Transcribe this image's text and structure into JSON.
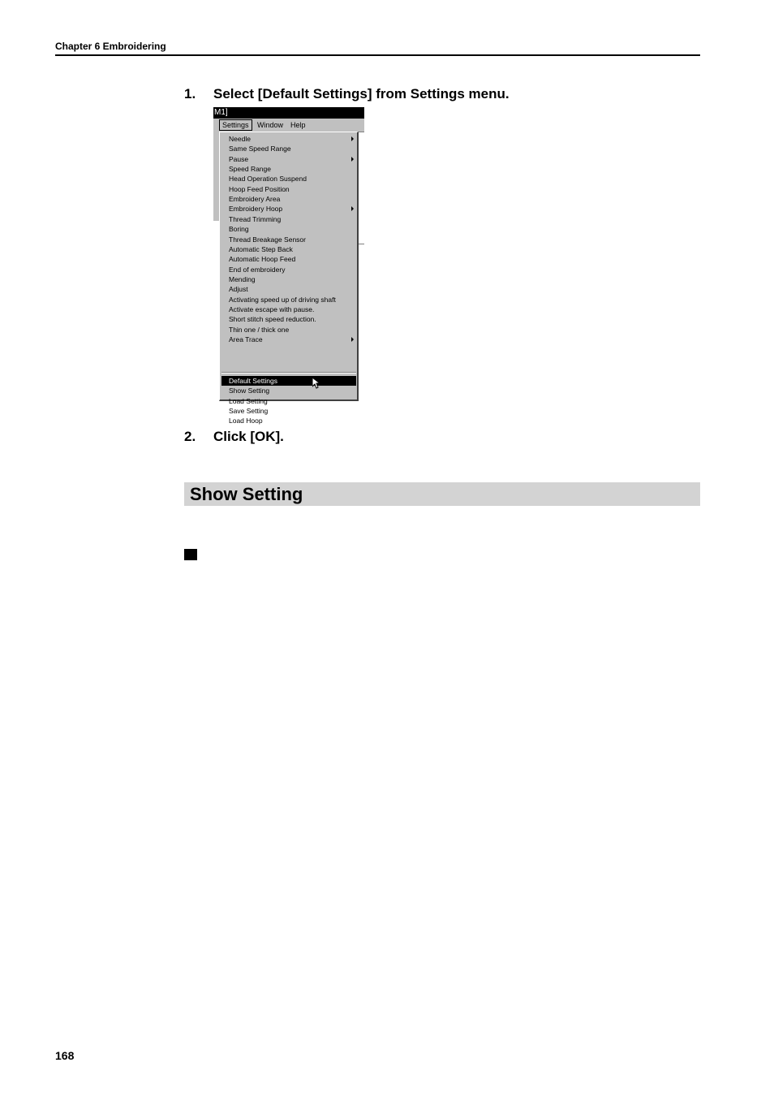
{
  "header": {
    "chapter": "Chapter 6  Embroidering"
  },
  "steps": [
    {
      "number": "1.",
      "text": "Select [Default Settings] from Settings menu."
    },
    {
      "number": "2.",
      "text": "Click [OK]."
    }
  ],
  "screenshot": {
    "title_fragment": "M1]",
    "menubar": [
      "Settings",
      "Window",
      "Help"
    ],
    "active_menu": "Settings",
    "menu_items": [
      {
        "label": "Needle",
        "submenu": true
      },
      {
        "label": "Same Speed Range",
        "submenu": false
      },
      {
        "label": "Pause",
        "submenu": true
      },
      {
        "label": "Speed Range",
        "submenu": false
      },
      {
        "label": "Head Operation Suspend",
        "submenu": false
      },
      {
        "label": "Hoop Feed Position",
        "submenu": false
      },
      {
        "label": "Embroidery Area",
        "submenu": false
      },
      {
        "label": "Embroidery Hoop",
        "submenu": true
      },
      {
        "label": "Thread Trimming",
        "submenu": false
      },
      {
        "label": "Boring",
        "submenu": false
      },
      {
        "label": "Thread Breakage Sensor",
        "submenu": false
      },
      {
        "label": "Automatic Step Back",
        "submenu": false
      },
      {
        "label": "Automatic Hoop Feed",
        "submenu": false
      },
      {
        "label": "End of embroidery",
        "submenu": false
      },
      {
        "label": "Mending",
        "submenu": false
      },
      {
        "label": "Adjust",
        "submenu": false
      },
      {
        "label": "Activating speed up of driving shaft",
        "submenu": false
      },
      {
        "label": "Activate escape with pause.",
        "submenu": false
      },
      {
        "label": "Short stitch speed reduction.",
        "submenu": false
      },
      {
        "label": "Thin one / thick one",
        "submenu": false
      },
      {
        "label": "Area Trace",
        "submenu": true
      }
    ],
    "menu_items_after_separator": [
      {
        "label": "Default Settings",
        "selected": true
      },
      {
        "label": "Show Setting",
        "selected": false
      },
      {
        "label": "Load Setting",
        "selected": false
      },
      {
        "label": "Save Setting",
        "selected": false
      },
      {
        "label": "Load Hoop",
        "selected": false
      }
    ]
  },
  "section": {
    "title": "Show Setting"
  },
  "footer": {
    "page_number": "168"
  }
}
